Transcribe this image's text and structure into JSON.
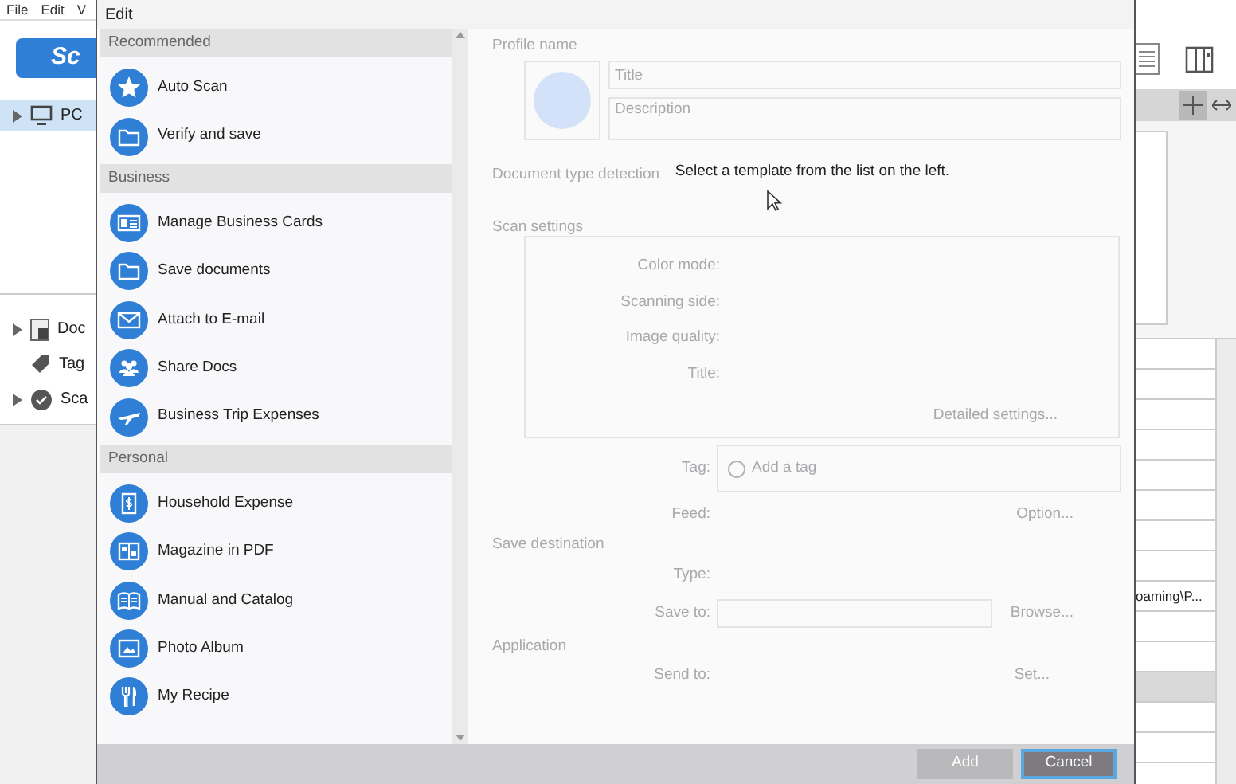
{
  "app": {
    "menu": [
      "File",
      "Edit",
      "V"
    ],
    "scan_button": "Sc",
    "tree": [
      {
        "label": "PC",
        "kind": "computer",
        "expandable": true,
        "selected": true
      }
    ],
    "nav": [
      {
        "label": "Doc",
        "kind": "documents",
        "expandable": true,
        "selected": false
      },
      {
        "label": "Tag",
        "kind": "tag",
        "expandable": false,
        "selected": false
      },
      {
        "label": "Sca",
        "kind": "scan",
        "expandable": true,
        "selected": false
      }
    ],
    "path_cell": "oaming\\P..."
  },
  "dialog": {
    "title": "Edit",
    "sections": [
      {
        "title": "Recommended",
        "items": [
          {
            "label": "Auto Scan",
            "kind": "star"
          },
          {
            "label": "Verify and save",
            "kind": "folder"
          }
        ]
      },
      {
        "title": "Business",
        "items": [
          {
            "label": "Manage Business Cards",
            "kind": "card"
          },
          {
            "label": "Save documents",
            "kind": "folder"
          },
          {
            "label": "Attach to E-mail",
            "kind": "mail"
          },
          {
            "label": "Share Docs",
            "kind": "people"
          },
          {
            "label": "Business Trip Expenses",
            "kind": "plane"
          }
        ]
      },
      {
        "title": "Personal",
        "items": [
          {
            "label": "Household Expense",
            "kind": "receipt"
          },
          {
            "label": "Magazine in PDF",
            "kind": "magazine"
          },
          {
            "label": "Manual and Catalog",
            "kind": "book"
          },
          {
            "label": "Photo Album",
            "kind": "photo"
          },
          {
            "label": "My Recipe",
            "kind": "cutlery"
          }
        ]
      }
    ],
    "hint": "Select a template from the list on the left.",
    "form": {
      "disabled": true,
      "profile_name": "Profile name",
      "title_placeholder": "Title",
      "description_placeholder": "Description",
      "doc_detection": "Document type detection",
      "scan_settings": "Scan settings",
      "scan_labels": [
        "Color mode:",
        "Scanning side:",
        "Image quality:",
        "Title:"
      ],
      "detailed": "Detailed settings...",
      "tag_label": "Tag:",
      "tag_add": "Add a tag",
      "feed_label": "Feed:",
      "option": "Option...",
      "save_destination": "Save destination",
      "type_label": "Type:",
      "save_to_label": "Save to:",
      "browse": "Browse...",
      "application": "Application",
      "send_to_label": "Send to:",
      "set": "Set..."
    },
    "buttons": [
      {
        "label": "Add",
        "disabled": true,
        "focused": false
      },
      {
        "label": "Cancel",
        "disabled": false,
        "focused": true
      }
    ]
  }
}
